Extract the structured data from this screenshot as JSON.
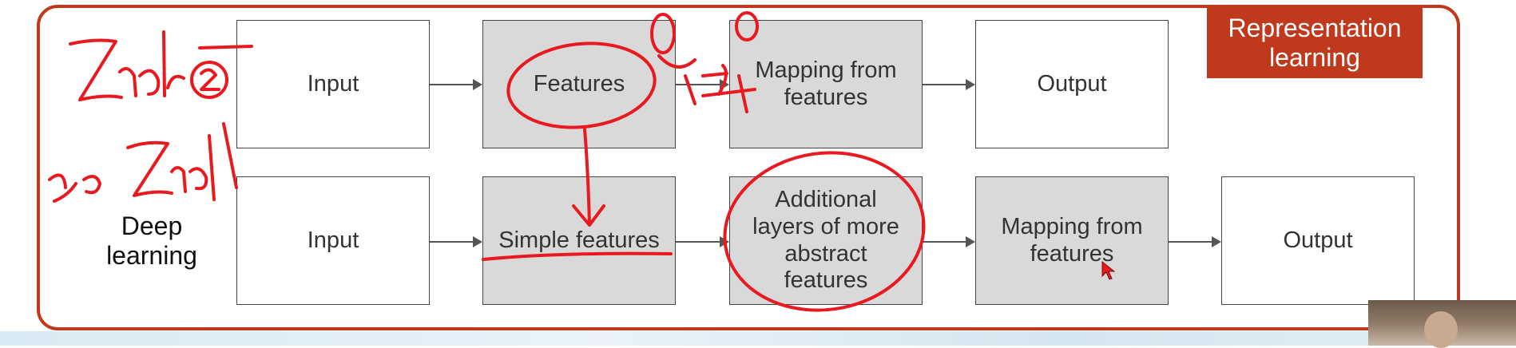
{
  "badge": {
    "line1": "Representation",
    "line2": "learning"
  },
  "row_label": {
    "line1": "Deep",
    "line2": "learning"
  },
  "top_row": [
    {
      "label": "Input",
      "style": "white"
    },
    {
      "label": "Features",
      "style": "gray"
    },
    {
      "line1": "Mapping from",
      "line2": "features",
      "style": "gray"
    },
    {
      "label": "Output",
      "style": "white"
    }
  ],
  "bottom_row": [
    {
      "label": "Input",
      "style": "white"
    },
    {
      "label": "Simple features",
      "style": "gray"
    },
    {
      "line1": "Additional",
      "line2": "layers of more",
      "line3": "abstract",
      "line4": "features",
      "style": "gray"
    },
    {
      "line1": "Mapping from",
      "line2": "features",
      "style": "gray"
    },
    {
      "label": "Output",
      "style": "white"
    }
  ],
  "colors": {
    "accent": "#c0391c",
    "ink": "#e8191f",
    "gray_box": "#d9d9d9"
  }
}
